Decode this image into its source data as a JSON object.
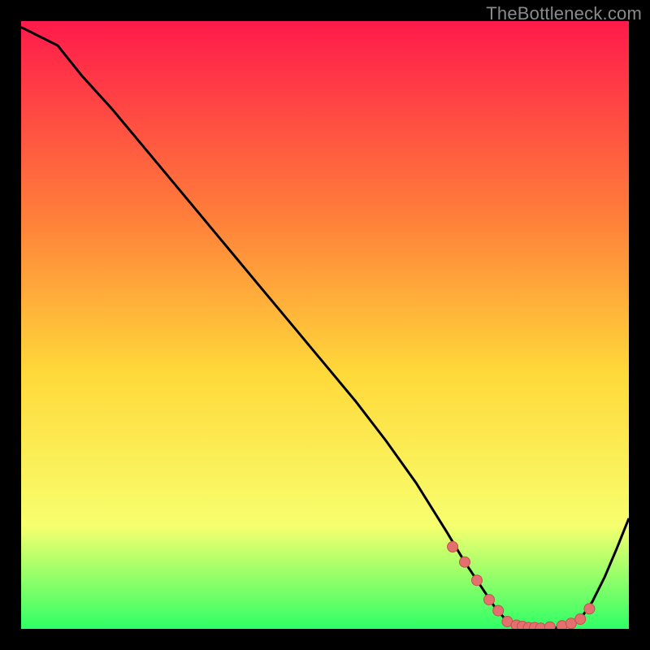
{
  "attribution": "TheBottleneck.com",
  "colors": {
    "bg": "#000000",
    "grad_top": "#ff1a4b",
    "grad_mid1": "#ff7e3a",
    "grad_mid2": "#ffd93a",
    "grad_mid3": "#f7ff6e",
    "grad_bottom": "#2fff66",
    "curve": "#000000",
    "marker_fill": "#e36f6f",
    "marker_stroke": "#c94f4f"
  },
  "chart_data": {
    "type": "line",
    "title": "",
    "xlabel": "",
    "ylabel": "",
    "xlim": [
      0,
      100
    ],
    "ylim": [
      0,
      100
    ],
    "x": [
      0,
      6,
      10,
      15,
      20,
      25,
      30,
      35,
      40,
      45,
      50,
      55,
      60,
      65,
      70,
      73,
      75,
      78,
      80,
      82,
      84,
      86,
      88,
      90,
      92,
      94,
      96,
      98,
      100
    ],
    "values": [
      99,
      96,
      91,
      85.5,
      79.5,
      73.5,
      67.5,
      61.5,
      55.5,
      49.5,
      43.5,
      37.5,
      31,
      24,
      16,
      11,
      8,
      3.5,
      1.2,
      0.5,
      0.2,
      0.1,
      0.2,
      0.6,
      1.6,
      4.5,
      8.5,
      13.2,
      18.2
    ],
    "markers_x": [
      71,
      73,
      75,
      77,
      78.5,
      80,
      81.5,
      82.5,
      83.5,
      84.5,
      85.5,
      87,
      89,
      90.5,
      92,
      93.5
    ],
    "markers_y": [
      13.5,
      11,
      8,
      4.8,
      3,
      1.2,
      0.6,
      0.4,
      0.2,
      0.2,
      0.1,
      0.3,
      0.5,
      0.9,
      1.6,
      3.3
    ]
  }
}
